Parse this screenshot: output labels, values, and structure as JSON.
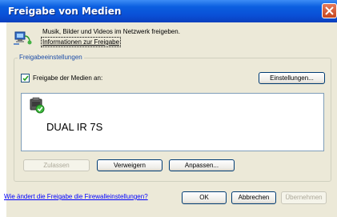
{
  "window": {
    "title": "Freigabe von Medien"
  },
  "info": {
    "description": "Musik, Bilder und Videos im Netzwerk freigeben.",
    "link": "Informationen zur Freigabe"
  },
  "sharing_settings": {
    "legend": "Freigabeeinstellungen",
    "share_checkbox_label": "Freigabe der Medien an:",
    "share_checked": true,
    "settings_button": "Einstellungen..."
  },
  "devices": [
    {
      "name": "DUAL IR 7S",
      "icon": "media-device-allowed-icon"
    }
  ],
  "device_actions": {
    "allow": "Zulassen",
    "deny": "Verweigern",
    "customize": "Anpassen..."
  },
  "footer": {
    "firewall_link": "Wie ändert die Freigabe die Firewalleinstellungen?",
    "ok": "OK",
    "cancel": "Abbrechen",
    "apply": "Übernehmen"
  }
}
